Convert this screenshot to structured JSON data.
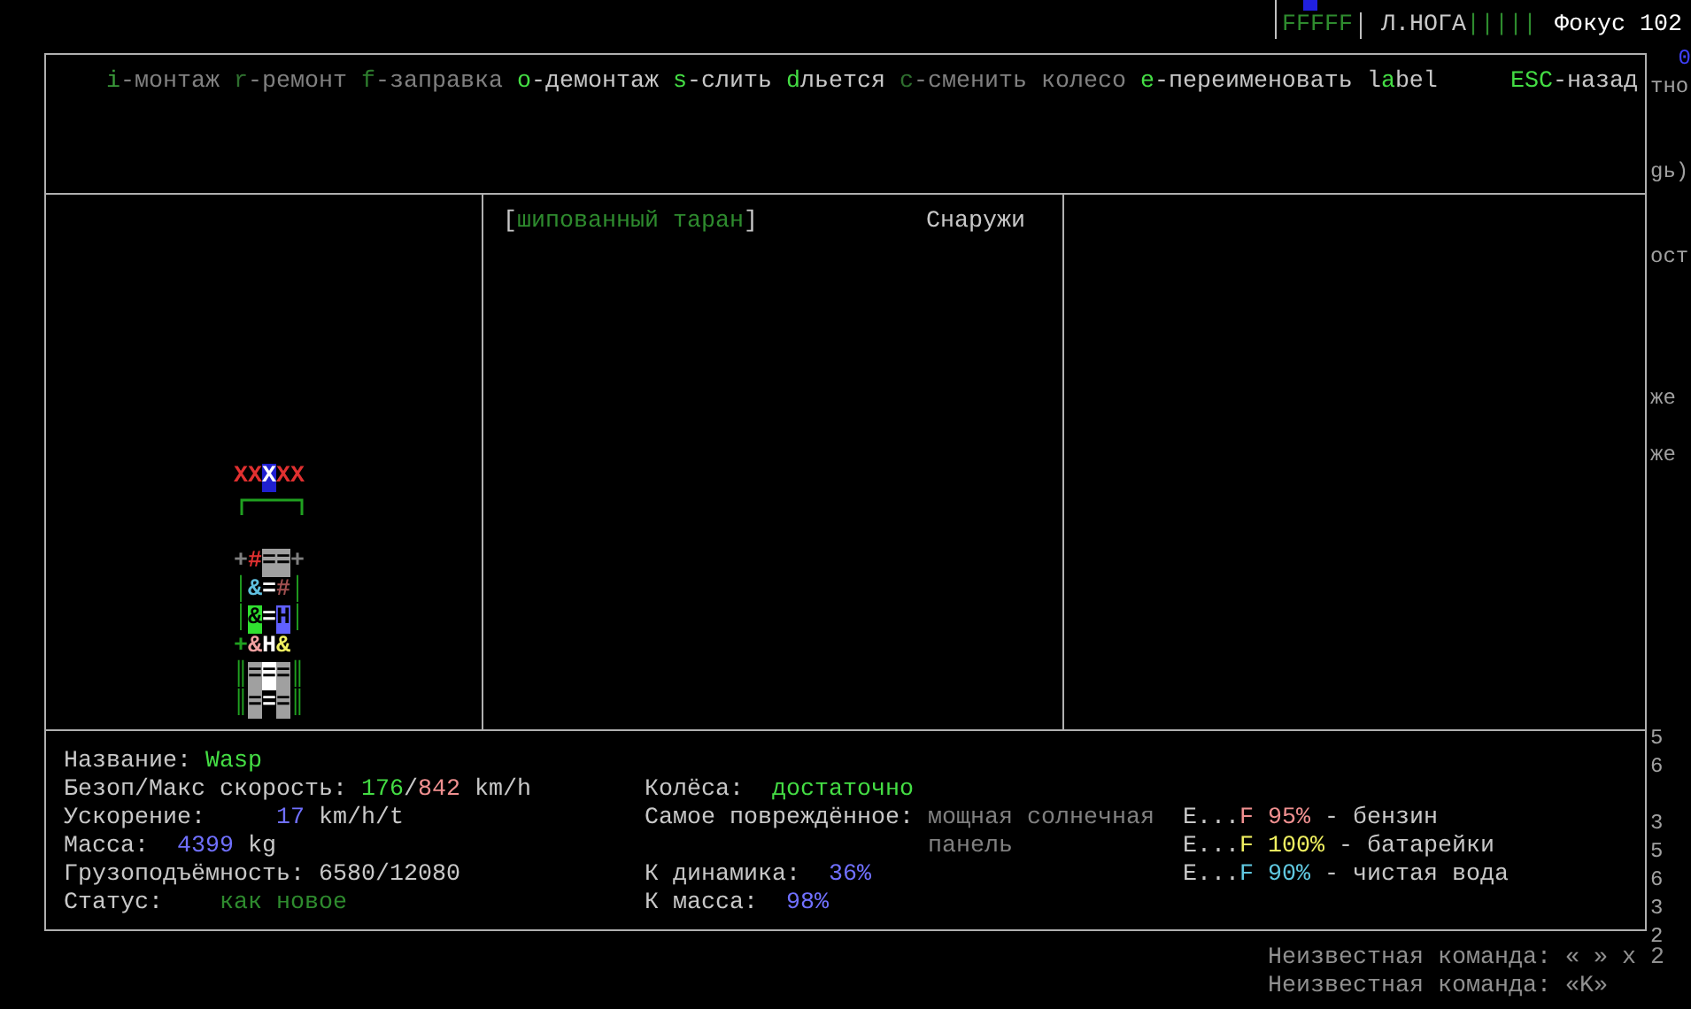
{
  "status_panel": {
    "limb_bar": "FFFFF",
    "limb_name": "Л.НОГА",
    "limb_health": "|||||",
    "focus": "Фокус 102"
  },
  "keys": [
    [
      {
        "text": "i",
        "color": "#3a9a3a"
      },
      {
        "text": "-монтаж",
        "color": "#808080"
      }
    ],
    [
      {
        "text": "r",
        "color": "#2e6e2e"
      },
      {
        "text": "-ремонт",
        "color": "#808080"
      }
    ],
    [
      {
        "text": "f",
        "color": "#2e7e2e"
      },
      {
        "text": "-заправка",
        "color": "#808080"
      }
    ],
    [
      {
        "text": "o",
        "color": "#44dd44"
      },
      {
        "text": "-демонтаж",
        "color": "#c8c8c8"
      }
    ],
    [
      {
        "text": "s",
        "color": "#44dd44"
      },
      {
        "text": "-слить",
        "color": "#c8c8c8"
      }
    ],
    [
      {
        "text": "d",
        "color": "#44dd44"
      },
      {
        "text": "льется",
        "color": "#c8c8c8"
      }
    ],
    [
      {
        "text": "c",
        "color": "#2e6e2e"
      },
      {
        "text": "-сменить колесо",
        "color": "#808080"
      }
    ],
    [
      {
        "text": "e",
        "color": "#44dd44"
      },
      {
        "text": "-переименовать",
        "color": "#c8c8c8"
      }
    ],
    [
      {
        "text": "l",
        "color": "#c8c8c8"
      },
      {
        "text": "a",
        "color": "#44dd44"
      },
      {
        "text": "bel",
        "color": "#c8c8c8"
      }
    ]
  ],
  "back_key": [
    {
      "text": "ESC",
      "color": "#44dd44"
    },
    {
      "text": "-назад",
      "color": "#c8c8c8"
    }
  ],
  "vehicle": {
    "rows": [
      {
        "kind": "cells",
        "cells": [
          {
            "ch": "X",
            "color": "#e03030"
          },
          {
            "ch": "X",
            "color": "#e03030"
          },
          {
            "ch": "X",
            "highlight": {
              "color": "#2020d0"
            }
          },
          {
            "ch": "X",
            "color": "#e03030"
          },
          {
            "ch": "X",
            "color": "#e03030"
          }
        ]
      },
      {
        "kind": "bracket"
      },
      {
        "kind": "blank"
      },
      {
        "kind": "cells",
        "cells": [
          {
            "ch": "+",
            "color": "#808080"
          },
          {
            "ch": "#",
            "color": "#e03030"
          },
          {
            "ch": "=",
            "highlight": {
              "color": "#a0a0a0"
            }
          },
          {
            "ch": "=",
            "highlight": {
              "color": "#a0a0a0"
            }
          },
          {
            "ch": "+",
            "color": "#808080"
          }
        ]
      },
      {
        "kind": "cells",
        "cells": [
          {
            "ch": "│",
            "color": "#20a020"
          },
          {
            "ch": "&",
            "color": "#60c0e0"
          },
          {
            "ch": "=",
            "color": "#ffffff"
          },
          {
            "ch": "#",
            "color": "#a05050"
          },
          {
            "ch": "│",
            "color": "#20a020"
          }
        ]
      },
      {
        "kind": "cells",
        "cells": [
          {
            "ch": "│",
            "color": "#20a020"
          },
          {
            "ch": "&",
            "highlight": {
              "color": "#30e030"
            }
          },
          {
            "ch": "="
          },
          {
            "ch": "H",
            "highlight": {
              "color": "#6060ff"
            }
          },
          {
            "ch": "│",
            "color": "#20a020"
          }
        ]
      },
      {
        "kind": "cells",
        "cells": [
          {
            "ch": "+",
            "color": "#20a020"
          },
          {
            "ch": "&",
            "color": "#f0a0a0"
          },
          {
            "ch": "H",
            "color": "#ffffff"
          },
          {
            "ch": "&",
            "color": "#f0f060"
          }
        ]
      },
      {
        "kind": "cells",
        "cells": [
          {
            "ch": "║",
            "color": "#20a020"
          },
          {
            "ch": "=",
            "highlight": {
              "color": "#a0a0a0"
            }
          },
          {
            "ch": "=",
            "highlight": {
              "color": "#ffffff"
            }
          },
          {
            "ch": "=",
            "highlight": {
              "color": "#a0a0a0"
            }
          },
          {
            "ch": "║",
            "color": "#20a020"
          }
        ]
      },
      {
        "kind": "cells",
        "cells": [
          {
            "ch": "║",
            "color": "#20a020"
          },
          {
            "ch": "=",
            "highlight": {
              "color": "#a0a0a0"
            }
          },
          {
            "ch": "="
          },
          {
            "ch": "=",
            "highlight": {
              "color": "#a0a0a0"
            }
          },
          {
            "ch": "║",
            "color": "#20a020"
          }
        ]
      }
    ]
  },
  "part": {
    "name": [
      {
        "text": "[",
        "color": "#c8c8c8"
      },
      {
        "text": "шипованный таран",
        "color": "#2e8b2e"
      },
      {
        "text": "]",
        "color": "#c8c8c8"
      }
    ],
    "location": "Снаружи"
  },
  "info_left": [
    [
      {
        "text": "Название: ",
        "color": "#c8c8c8"
      },
      {
        "text": "Wasp",
        "color": "#44dd44"
      }
    ],
    [
      {
        "text": "Безоп/Макс скорость: ",
        "color": "#c8c8c8"
      },
      {
        "text": "176",
        "color": "#44dd44"
      },
      {
        "text": "/",
        "color": "#c8c8c8"
      },
      {
        "text": "842",
        "color": "#f09090"
      },
      {
        "text": " km/h",
        "color": "#c8c8c8"
      }
    ],
    [
      {
        "text": "Ускорение:",
        "color": "#c8c8c8"
      },
      {
        "text": "     17",
        "color": "#7070ff"
      },
      {
        "text": " km/h/t",
        "color": "#c8c8c8"
      }
    ],
    [
      {
        "text": "Масса:",
        "color": "#c8c8c8"
      },
      {
        "text": "  4399",
        "color": "#7070ff"
      },
      {
        "text": " kg",
        "color": "#c8c8c8"
      }
    ],
    [
      {
        "text": "Грузоподъёмность: 6580/12080",
        "color": "#c8c8c8"
      }
    ],
    [
      {
        "text": "Статус:",
        "color": "#c8c8c8"
      },
      {
        "text": "    как новое",
        "color": "#2e8b2e"
      }
    ]
  ],
  "wheels": {
    "label": "Колёса:",
    "value": "достаточно"
  },
  "most_damaged": {
    "label": "Самое повреждённое:",
    "value": "мощная солнечная панель"
  },
  "coefficients": [
    {
      "label": "К динамика:",
      "value": "36%"
    },
    {
      "label": "К масса:",
      "value": "98%"
    }
  ],
  "tanks": [
    {
      "gauge": "E...",
      "full": "F",
      "percent": "95%",
      "name": " - бензин",
      "color": "#f09090"
    },
    {
      "gauge": "E...",
      "full": "F",
      "percent": "100%",
      "name": " - батарейки",
      "color": "#f0f060"
    },
    {
      "gauge": "E...",
      "full": "F",
      "percent": "90%",
      "name": " - чистая вода",
      "color": "#60c8e0"
    }
  ],
  "edge_fragments": [
    "0",
    "тно",
    "gь)",
    "ост",
    "же",
    "же",
    "5",
    "6",
    "3",
    "5",
    "6",
    "3",
    "2"
  ],
  "messages": [
    "Неизвестная команда: « » x 2",
    "Неизвестная команда: «K»"
  ]
}
